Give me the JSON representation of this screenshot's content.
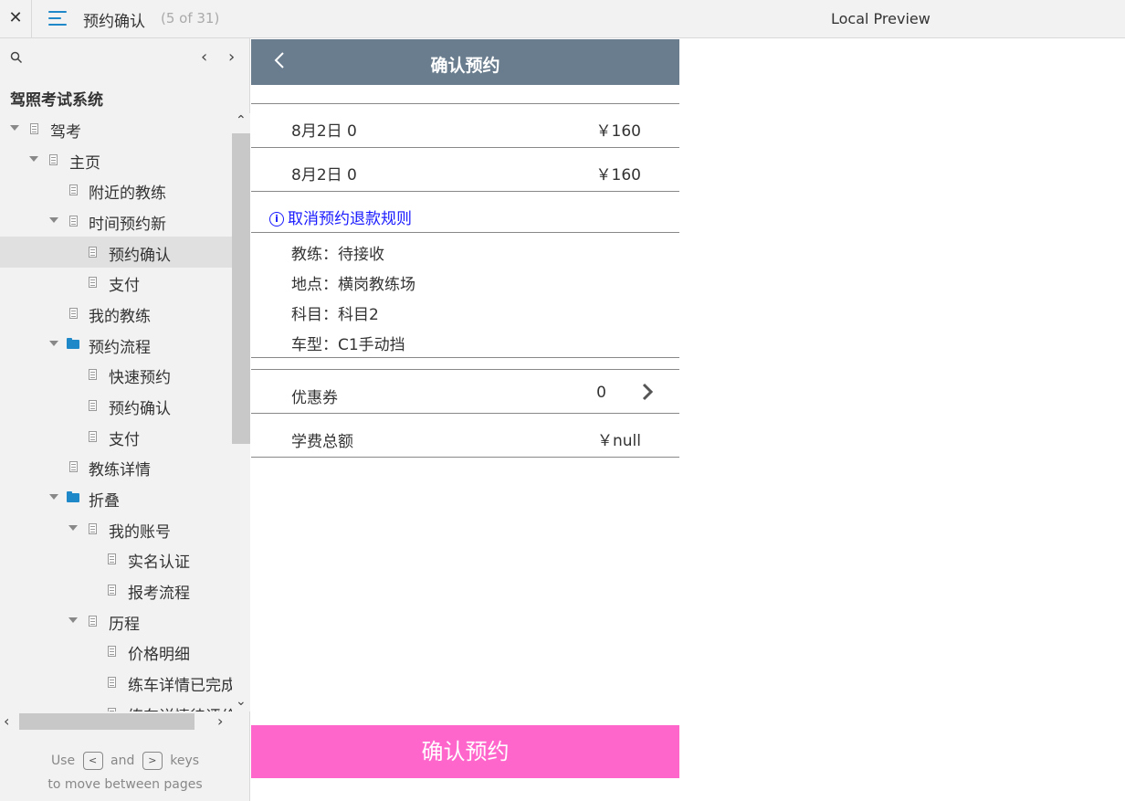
{
  "topbar": {
    "close": "✕",
    "page_title": "预约确认",
    "page_count": "(5 of 31)",
    "preview_label": "Local Preview"
  },
  "sidebar": {
    "prev": "‹",
    "next": "›",
    "project_name": "驾照考试系统",
    "tree": [
      {
        "label": "驾考",
        "type": "page",
        "expanded": true
      },
      {
        "label": "主页",
        "type": "page",
        "expanded": true
      },
      {
        "label": "附近的教练",
        "type": "page"
      },
      {
        "label": "时间预约新",
        "type": "page",
        "expanded": true
      },
      {
        "label": "预约确认",
        "type": "page",
        "selected": true
      },
      {
        "label": "支付",
        "type": "page"
      },
      {
        "label": "我的教练",
        "type": "page"
      },
      {
        "label": "预约流程",
        "type": "folder",
        "expanded": true
      },
      {
        "label": "快速预约",
        "type": "page"
      },
      {
        "label": "预约确认",
        "type": "page"
      },
      {
        "label": "支付",
        "type": "page"
      },
      {
        "label": "教练详情",
        "type": "page"
      },
      {
        "label": "折叠",
        "type": "folder",
        "expanded": true
      },
      {
        "label": "我的账号",
        "type": "page",
        "expanded": true
      },
      {
        "label": "实名认证",
        "type": "page"
      },
      {
        "label": "报考流程",
        "type": "page"
      },
      {
        "label": "历程",
        "type": "page",
        "expanded": true
      },
      {
        "label": "价格明细",
        "type": "page"
      },
      {
        "label": "练车详情已完成",
        "type": "page"
      },
      {
        "label": "练车详情待评价",
        "type": "page"
      }
    ],
    "hint": {
      "use": "Use",
      "and": "and",
      "keys": "keys",
      "line2": "to move between pages",
      "key_prev": "<",
      "key_next": ">"
    }
  },
  "phone": {
    "header_title": "确认预约",
    "slots": [
      {
        "time": "8月2日 0",
        "price": "￥160"
      },
      {
        "time": "8月2日 0",
        "price": "￥160"
      }
    ],
    "refund_rule": "取消预约退款规则",
    "info_icon": "i",
    "details": [
      {
        "label": "教练：待接收"
      },
      {
        "label": "地点：横岗教练场"
      },
      {
        "label": "科目：科目2"
      },
      {
        "label": "车型：C1手动挡"
      }
    ],
    "coupon": {
      "label": "优惠券",
      "value": "0"
    },
    "total": {
      "label": "学费总额",
      "value": "￥null"
    },
    "confirm_button": "确认预约",
    "colors": {
      "header": "#6a7d8e",
      "confirm": "#ff66cc",
      "link": "#1a1aff"
    }
  }
}
